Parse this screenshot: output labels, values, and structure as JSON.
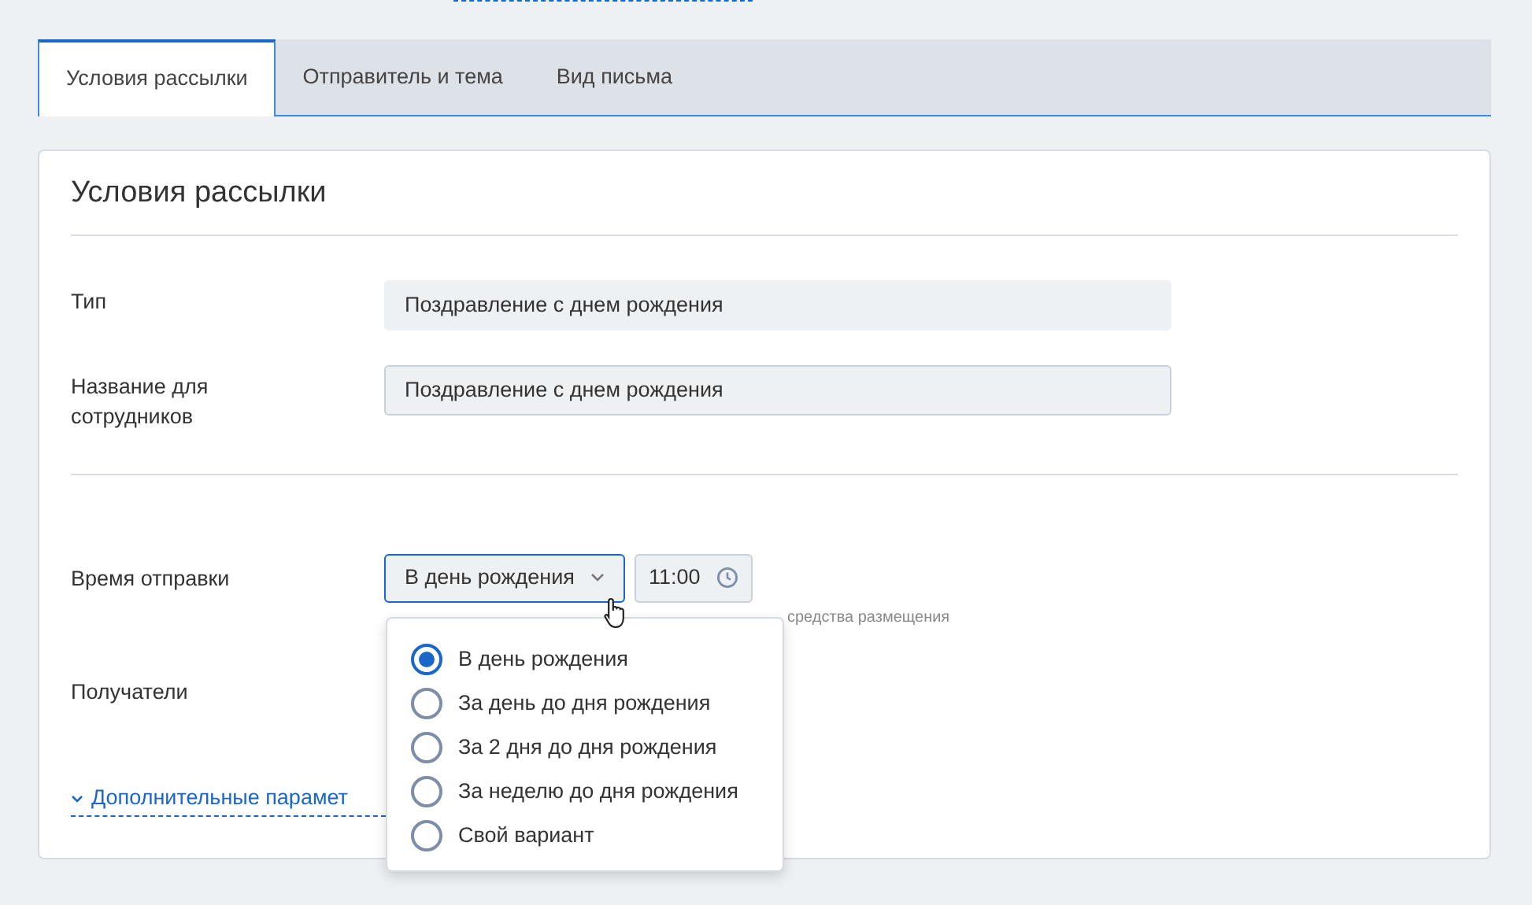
{
  "tabs": [
    {
      "label": "Условия рассылки",
      "selected": true
    },
    {
      "label": "Отправитель и тема",
      "selected": false
    },
    {
      "label": "Вид письма",
      "selected": false
    }
  ],
  "section": {
    "title": "Условия рассылки"
  },
  "fields": [
    {
      "label": "Тип",
      "value": "Поздравление с днем рождения",
      "disabled": true
    },
    {
      "label": "Название для сотрудников",
      "value": "Поздравление с днем рождения",
      "disabled": false
    }
  ],
  "send_time": {
    "label": "Время отправки",
    "select_value": "В день рождения",
    "time": "11:00",
    "hint": "средства размещения"
  },
  "recipients": {
    "label": "Получатели"
  },
  "more_link": "Дополнительные парамет",
  "dropdown": {
    "options": [
      {
        "label": "В день рождения",
        "selected": true
      },
      {
        "label": "За день до дня рождения",
        "selected": false
      },
      {
        "label": "За 2 дня до дня рождения",
        "selected": false
      },
      {
        "label": "За неделю до дня рождения",
        "selected": false
      },
      {
        "label": "Свой вариант",
        "selected": false
      }
    ]
  }
}
